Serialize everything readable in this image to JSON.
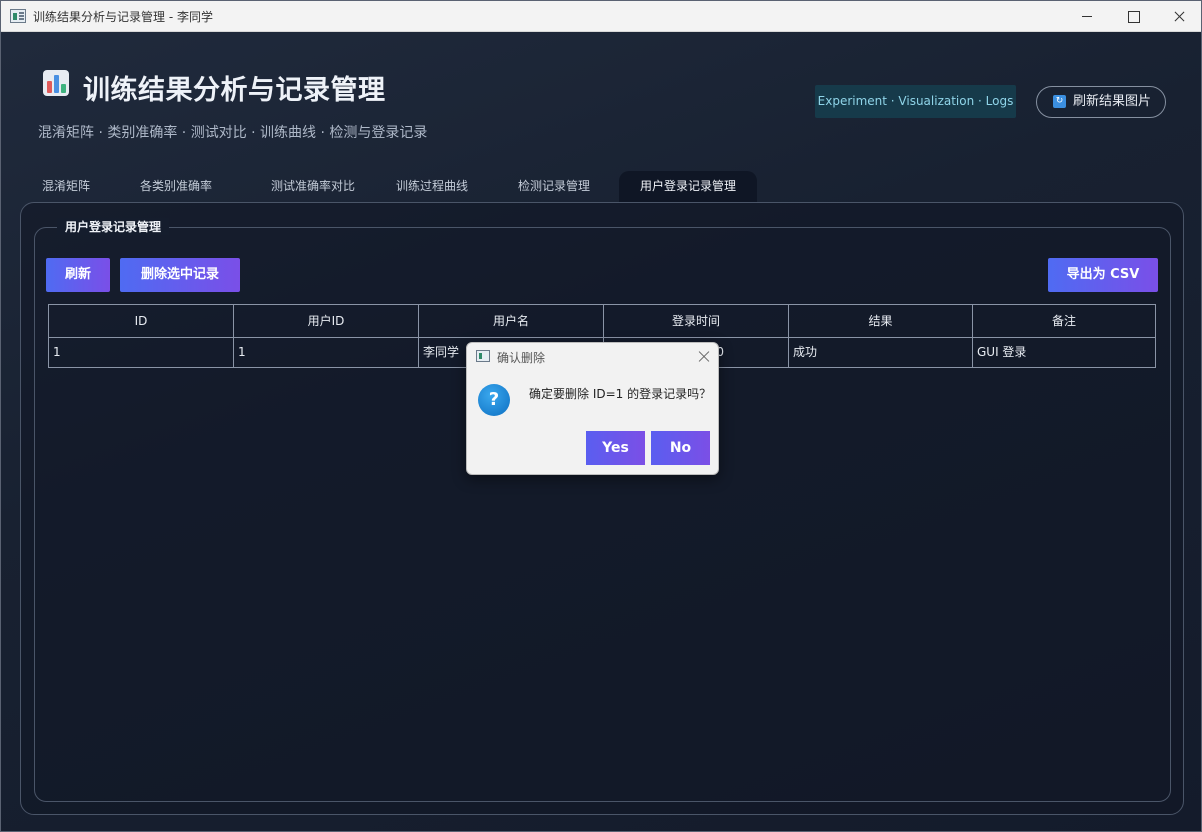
{
  "window": {
    "title": "训练结果分析与记录管理 - 李同学"
  },
  "header": {
    "title": "训练结果分析与记录管理",
    "subtitle": "混淆矩阵 · 类别准确率 · 测试对比 · 训练曲线 · 检测与登录记录",
    "badge": "Experiment · Visualization · Logs",
    "refresh_images_label": "刷新结果图片"
  },
  "tabs": [
    {
      "label": "混淆矩阵"
    },
    {
      "label": "各类别准确率"
    },
    {
      "label": "测试准确率对比"
    },
    {
      "label": "训练过程曲线"
    },
    {
      "label": "检测记录管理"
    },
    {
      "label": "用户登录记录管理",
      "active": true
    }
  ],
  "panel": {
    "group_title": "用户登录记录管理",
    "refresh_label": "刷新",
    "delete_label": "删除选中记录",
    "export_label": "导出为 CSV"
  },
  "table": {
    "columns": [
      "ID",
      "用户ID",
      "用户名",
      "登录时间",
      "结果",
      "备注"
    ],
    "rows": [
      {
        "id": "1",
        "user_id": "1",
        "username": "李同学",
        "login_time_visible": "0",
        "result": "成功",
        "note": "GUI 登录"
      }
    ]
  },
  "dialog": {
    "title": "确认删除",
    "message": "确定要删除 ID=1 的登录记录吗？",
    "yes_label": "Yes",
    "no_label": "No"
  }
}
